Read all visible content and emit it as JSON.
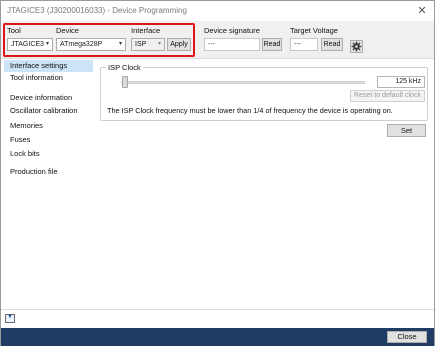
{
  "window": {
    "title": "JTAGICE3 (J30200016033) - Device Programming",
    "close_glyph": "✕"
  },
  "toolbar": {
    "tool": {
      "label": "Tool",
      "value": "JTAGICE3"
    },
    "device": {
      "label": "Device",
      "value": "ATmega328P"
    },
    "interface": {
      "label": "Interface",
      "value": "ISP",
      "apply_label": "Apply"
    },
    "device_signature": {
      "label": "Device signature",
      "value": "---",
      "read_label": "Read"
    },
    "target_voltage": {
      "label": "Target Voltage",
      "value": "---",
      "read_label": "Read"
    },
    "settings_icon": "gear-icon",
    "dropdown_arrow": "▾"
  },
  "sidebar": {
    "items": [
      {
        "label": "Interface settings",
        "selected": true
      },
      {
        "label": "Tool information",
        "selected": false
      },
      {
        "label": "Device information",
        "selected": false
      },
      {
        "label": "Oscillator calibration",
        "selected": false
      },
      {
        "label": "Memories",
        "selected": false
      },
      {
        "label": "Fuses",
        "selected": false
      },
      {
        "label": "Lock bits",
        "selected": false
      },
      {
        "label": "Production file",
        "selected": false
      }
    ]
  },
  "isp_clock": {
    "group_title": "ISP Clock",
    "value": "125 kHz",
    "reset_label": "Reset to default clock",
    "note": "The ISP Clock frequency must be lower than 1/4 of frequency the device is operating on.",
    "set_label": "Set"
  },
  "footer": {
    "expand_glyph": "▼",
    "close_label": "Close"
  },
  "colors": {
    "highlight": "#e0121a",
    "selection": "#cce4f7",
    "bottom_bar": "#1e3c64"
  }
}
